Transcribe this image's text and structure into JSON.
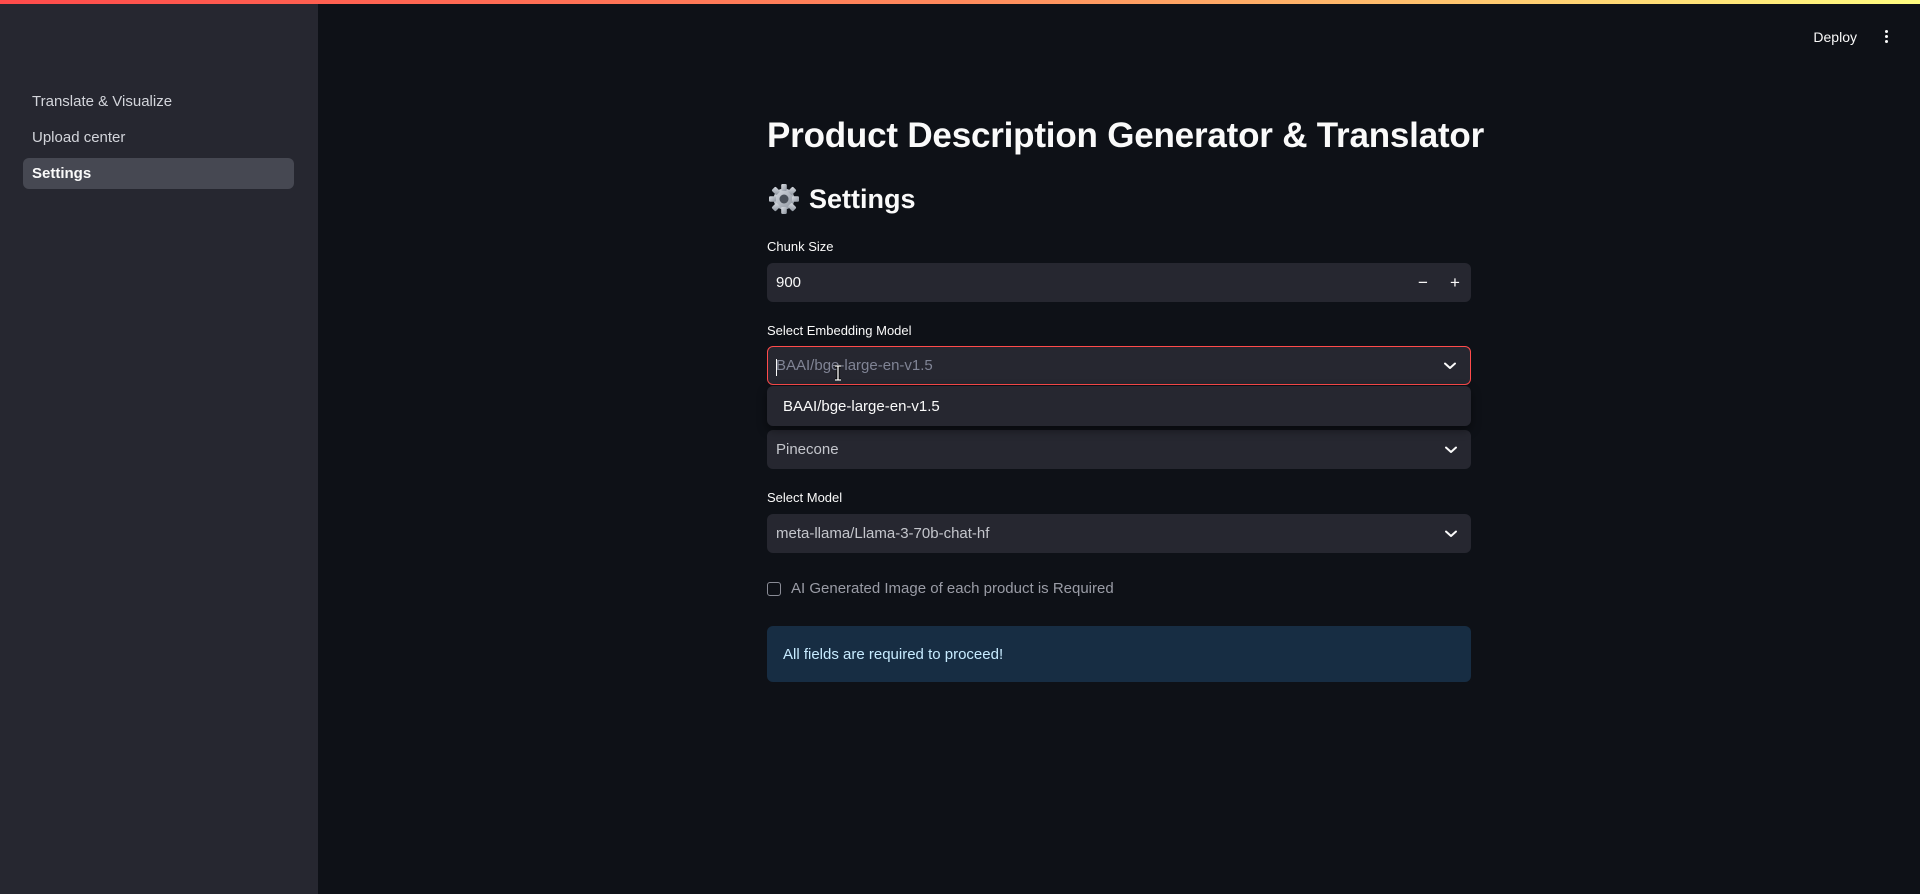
{
  "sidebar": {
    "items": [
      {
        "label": "Translate & Visualize"
      },
      {
        "label": "Upload center"
      },
      {
        "label": "Settings"
      }
    ]
  },
  "header": {
    "deploy_label": "Deploy",
    "menu_icon": "kebab-menu-icon"
  },
  "main": {
    "title": "Product Description Generator & Translator",
    "section_title": "Settings",
    "section_icon": "gear-icon",
    "chunk_size": {
      "label": "Chunk Size",
      "value": "900",
      "decrement_label": "−",
      "increment_label": "+"
    },
    "embedding_model": {
      "label": "Select Embedding Model",
      "placeholder": "BAAI/bge-large-en-v1.5",
      "options": [
        "BAAI/bge-large-en-v1.5"
      ]
    },
    "vector_store": {
      "value": "Pinecone"
    },
    "model": {
      "label": "Select Model",
      "value": "meta-llama/Llama-3-70b-chat-hf"
    },
    "ai_image_checkbox": {
      "label": "AI Generated Image of each product is Required",
      "checked": false
    },
    "info_message": "All fields are required to proceed!"
  },
  "colors": {
    "background": "#0e1117",
    "sidebar": "#262730",
    "accent": "#ff4b4b",
    "info_bg": "#172d43",
    "info_text": "#c7ebff"
  }
}
